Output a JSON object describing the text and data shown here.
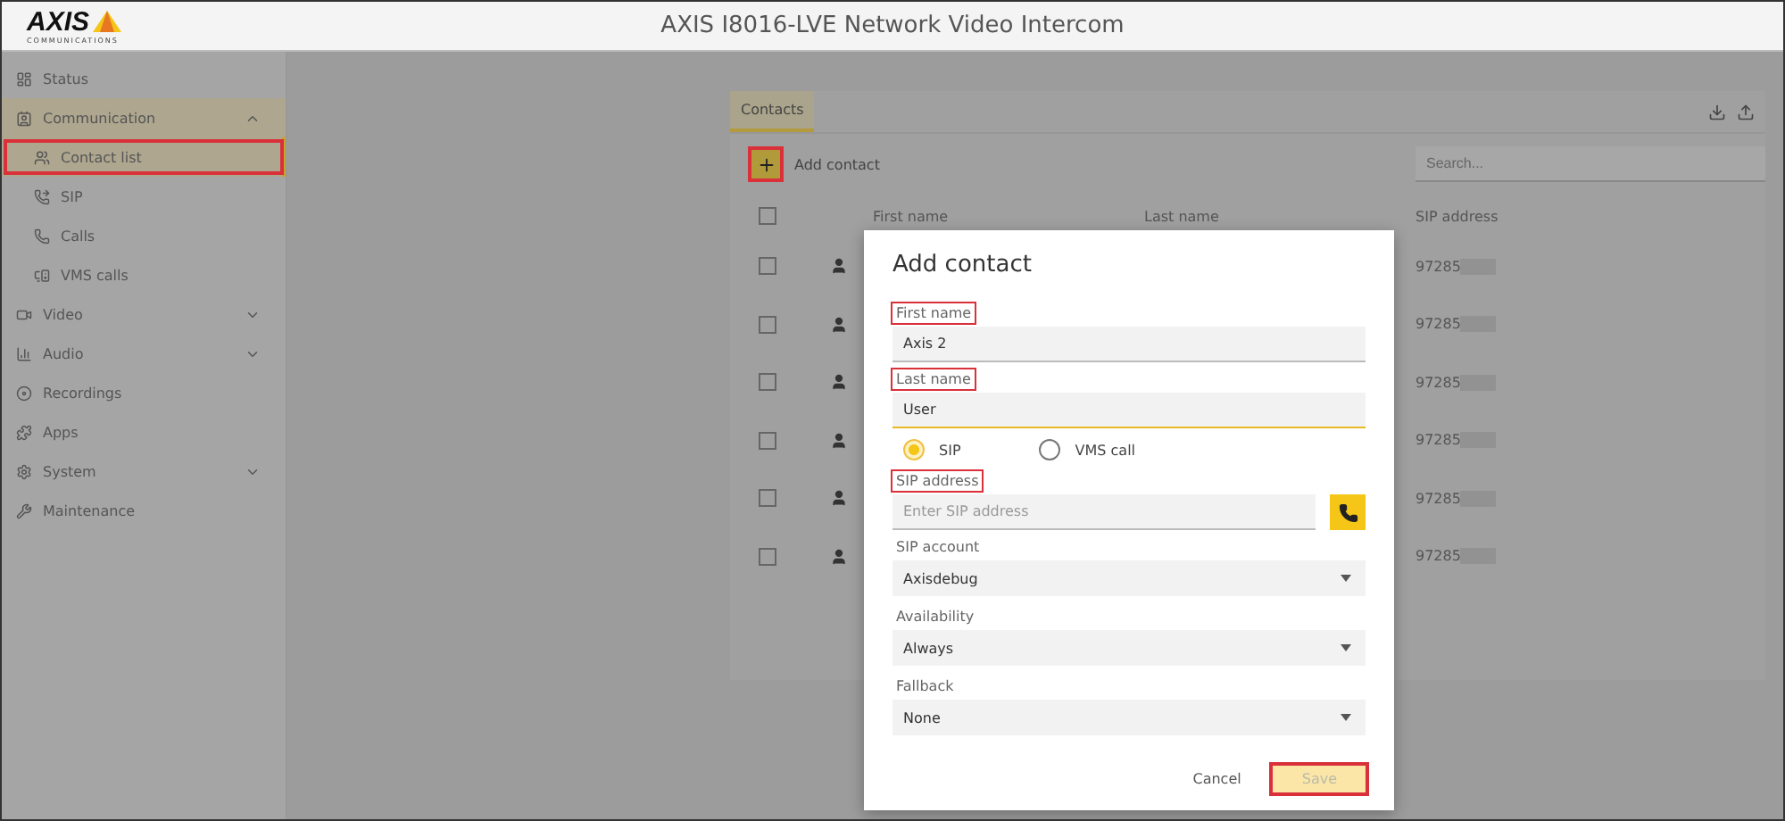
{
  "header": {
    "logo": "AXIS",
    "logo_sub": "COMMUNICATIONS",
    "title": "AXIS I8016-LVE Network Video Intercom"
  },
  "sidebar": {
    "items": [
      {
        "label": "Status",
        "selected": false
      },
      {
        "label": "Communication",
        "selected": false,
        "expanded": true,
        "children": [
          {
            "label": "Contact list",
            "selected": true,
            "highlighted": true
          },
          {
            "label": "SIP",
            "selected": false
          },
          {
            "label": "Calls",
            "selected": false
          },
          {
            "label": "VMS calls",
            "selected": false
          }
        ]
      },
      {
        "label": "Video",
        "selected": false,
        "expanded": false
      },
      {
        "label": "Audio",
        "selected": false,
        "expanded": false
      },
      {
        "label": "Recordings",
        "selected": false
      },
      {
        "label": "Apps",
        "selected": false
      },
      {
        "label": "System",
        "selected": false,
        "expanded": false
      },
      {
        "label": "Maintenance",
        "selected": false
      }
    ]
  },
  "panel": {
    "tabs": [
      {
        "label": "Contacts",
        "selected": true
      }
    ],
    "add_button": {
      "label": "Add contact",
      "highlighted": true
    },
    "search": {
      "placeholder": "Search..."
    },
    "table": {
      "select_all_checked": false,
      "columns": [
        "First name",
        "Last name",
        "SIP address"
      ],
      "rows": [
        {
          "checked": false,
          "sip_address": "97285"
        },
        {
          "checked": false,
          "sip_address": "97285"
        },
        {
          "checked": false,
          "sip_address": "97285"
        },
        {
          "checked": false,
          "sip_address": "97285"
        },
        {
          "checked": false,
          "sip_address": "97285"
        },
        {
          "checked": false,
          "sip_address": "97285"
        }
      ]
    }
  },
  "dialog": {
    "title": "Add contact",
    "fields": [
      {
        "kind": "text",
        "label": "First name",
        "value": "Axis 2",
        "focused": false,
        "highlighted": true
      },
      {
        "kind": "text",
        "label": "Last name",
        "value": "User",
        "focused": true,
        "highlighted": true
      },
      {
        "kind": "radio",
        "options": [
          {
            "label": "SIP",
            "selected": true
          },
          {
            "label": "VMS call",
            "selected": false
          }
        ]
      },
      {
        "kind": "text",
        "label": "SIP address",
        "placeholder": "Enter SIP address",
        "focused": false,
        "highlighted": true,
        "call_button": true
      },
      {
        "kind": "select",
        "label": "SIP account",
        "value": "Axisdebug"
      },
      {
        "kind": "select",
        "label": "Availability",
        "value": "Always"
      },
      {
        "kind": "select",
        "label": "Fallback",
        "value": "None"
      }
    ],
    "buttons": [
      {
        "kind": "text",
        "label": "Cancel",
        "highlighted": false
      },
      {
        "kind": "primary",
        "label": "Save",
        "disabled": true,
        "highlighted": true
      }
    ]
  }
}
